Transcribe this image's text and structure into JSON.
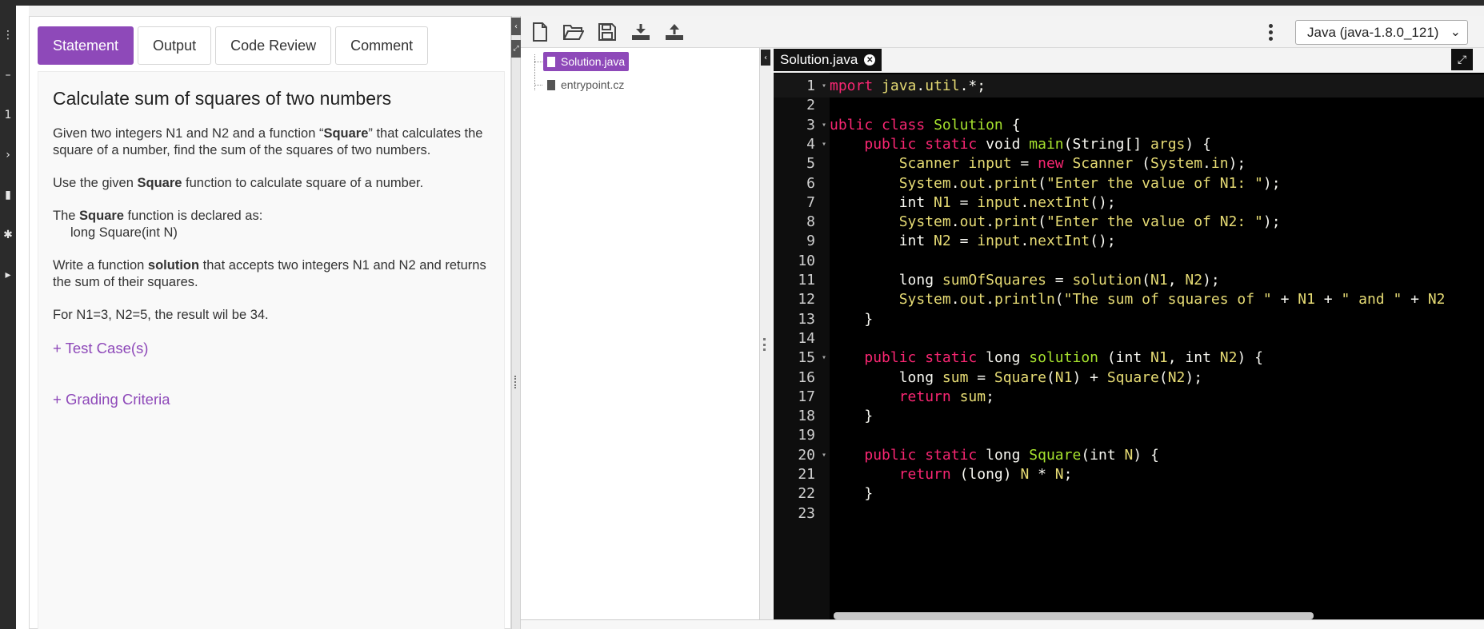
{
  "colors": {
    "accent": "#8e49b9",
    "editor_bg": "#000000"
  },
  "left_rail": {
    "icons": [
      "menu-icon",
      "minus-icon",
      "list-icon",
      "chevron-right-icon",
      "bookmark-icon",
      "gear-icon",
      "arrow-right-icon"
    ]
  },
  "tabs": [
    {
      "label": "Statement",
      "active": true
    },
    {
      "label": "Output",
      "active": false
    },
    {
      "label": "Code Review",
      "active": false
    },
    {
      "label": "Comment",
      "active": false
    }
  ],
  "statement": {
    "title": "Calculate sum of squares of two numbers",
    "para1_prefix": "Given two integers N1 and N2 and a function “",
    "para1_bold": "Square",
    "para1_suffix": "” that calculates the square of a number, find the sum of the squares of two numbers.",
    "para2_prefix": "Use the given ",
    "para2_bold": "Square",
    "para2_suffix": " function to calculate square of a number.",
    "para3_prefix": "The ",
    "para3_bold": "Square",
    "para3_suffix": " function is declared as:",
    "para3_code": "long Square(int N)",
    "para4_prefix": "Write a function ",
    "para4_bold": "solution",
    "para4_suffix": " that accepts two integers N1 and N2 and returns the sum of their squares.",
    "para5": "For N1=3, N2=5, the result wil be 34.",
    "test_cases_link": "+ Test Case(s)",
    "grading_link": "+ Grading Criteria"
  },
  "toolbar": {
    "icons": [
      "new-file-icon",
      "open-folder-icon",
      "save-icon",
      "download-icon",
      "upload-icon",
      "more-vertical-icon"
    ],
    "language": "Java (java-1.8.0_121)"
  },
  "file_tree": {
    "files": [
      {
        "name": "Solution.java",
        "selected": true
      },
      {
        "name": "entrypoint.cz",
        "selected": false
      }
    ]
  },
  "editor": {
    "tab_label": "Solution.java",
    "lines": [
      {
        "n": "1",
        "fold": true,
        "html": "<span class='kw'>mport</span> <span class='id'>java</span>.<span class='id'>util</span>.*;"
      },
      {
        "n": "2",
        "fold": false,
        "html": ""
      },
      {
        "n": "3",
        "fold": true,
        "html": "<span class='kw'>ublic</span> <span class='kw'>class</span> <span class='cl'>Solution</span> {"
      },
      {
        "n": "4",
        "fold": true,
        "html": "    <span class='kw'>public</span> <span class='kw'>static</span> void <span class='fn'>main</span>(String[] <span class='id'>args</span>) {"
      },
      {
        "n": "5",
        "fold": false,
        "html": "        <span class='id'>Scanner</span> <span class='id'>input</span> = <span class='kw'>new</span> <span class='id'>Scanner</span> (<span class='id'>System</span>.<span class='id'>in</span>);"
      },
      {
        "n": "6",
        "fold": false,
        "html": "        <span class='id'>System</span>.<span class='id'>out</span>.<span class='id'>print</span>(<span class='st'>\"Enter the value of N1: \"</span>);"
      },
      {
        "n": "7",
        "fold": false,
        "html": "        int <span class='id'>N1</span> = <span class='id'>input</span>.<span class='id'>nextInt</span>();"
      },
      {
        "n": "8",
        "fold": false,
        "html": "        <span class='id'>System</span>.<span class='id'>out</span>.<span class='id'>print</span>(<span class='st'>\"Enter the value of N2: \"</span>);"
      },
      {
        "n": "9",
        "fold": false,
        "html": "        int <span class='id'>N2</span> = <span class='id'>input</span>.<span class='id'>nextInt</span>();"
      },
      {
        "n": "10",
        "fold": false,
        "html": ""
      },
      {
        "n": "11",
        "fold": false,
        "html": "        long <span class='id'>sumOfSquares</span> = <span class='id'>solution</span>(<span class='id'>N1</span>, <span class='id'>N2</span>);"
      },
      {
        "n": "12",
        "fold": false,
        "html": "        <span class='id'>System</span>.<span class='id'>out</span>.<span class='id'>println</span>(<span class='st'>\"The sum of squares of \"</span> + <span class='id'>N1</span> + <span class='st'>\" and \"</span> + <span class='id'>N2</span>"
      },
      {
        "n": "13",
        "fold": false,
        "html": "    }"
      },
      {
        "n": "14",
        "fold": false,
        "html": ""
      },
      {
        "n": "15",
        "fold": true,
        "html": "    <span class='kw'>public</span> <span class='kw'>static</span> long <span class='fn'>solution</span> (int <span class='id'>N1</span>, int <span class='id'>N2</span>) {"
      },
      {
        "n": "16",
        "fold": false,
        "html": "        long <span class='id'>sum</span> = <span class='id'>Square</span>(<span class='id'>N1</span>) + <span class='id'>Square</span>(<span class='id'>N2</span>);"
      },
      {
        "n": "17",
        "fold": false,
        "html": "        <span class='kw'>return</span> <span class='id'>sum</span>;"
      },
      {
        "n": "18",
        "fold": false,
        "html": "    }"
      },
      {
        "n": "19",
        "fold": false,
        "html": ""
      },
      {
        "n": "20",
        "fold": true,
        "html": "    <span class='kw'>public</span> <span class='kw'>static</span> long <span class='fn'>Square</span>(int <span class='id'>N</span>) {"
      },
      {
        "n": "21",
        "fold": false,
        "html": "        <span class='kw'>return</span> (long) <span class='id'>N</span> * <span class='id'>N</span>;"
      },
      {
        "n": "22",
        "fold": false,
        "html": "    }"
      },
      {
        "n": "23",
        "fold": false,
        "html": ""
      }
    ]
  }
}
